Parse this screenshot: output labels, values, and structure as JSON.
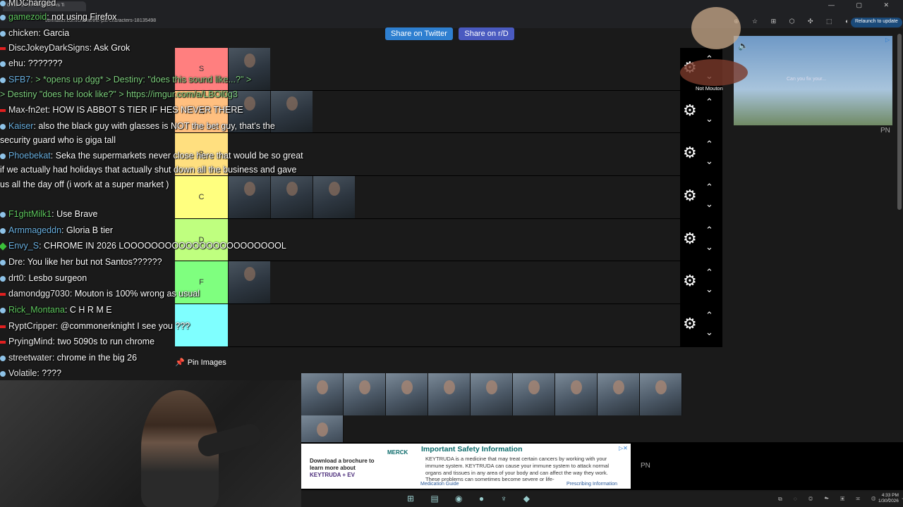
{
  "browser": {
    "tab_title": "Create a The Pitt characters Ti",
    "url": "tiermaker.com/create/the-pitt-characters-18135498",
    "window_controls": "—  ▢  ✕",
    "relaunch_label": "Relaunch to update"
  },
  "share": {
    "twitter_label": "Share on Twitter",
    "reddit_label": "Share on r/D"
  },
  "tiers": [
    {
      "label": "S",
      "color": "#ff7f7f",
      "image_count": 1
    },
    {
      "label": "A",
      "color": "#ffbf7f",
      "image_count": 2
    },
    {
      "label": "B",
      "color": "#ffdf7f",
      "image_count": 0
    },
    {
      "label": "C",
      "color": "#ffff7f",
      "image_count": 3
    },
    {
      "label": "D",
      "color": "#bfff7f",
      "image_count": 0
    },
    {
      "label": "F",
      "color": "#7fff7f",
      "image_count": 1
    },
    {
      "label": "",
      "color": "#7fffff",
      "image_count": 0
    }
  ],
  "tier_controls": {
    "gear_icon": "⚙",
    "up_icon": "⌃",
    "down_icon": "⌄"
  },
  "chat": [
    {
      "badge": "blue",
      "user": "MDCharged",
      "user_color": "#f0f0f0",
      "text": "",
      "wrap": false
    },
    {
      "badge": "blue",
      "user": "gamezoid",
      "user_color": "#5fc85f",
      "text": ": not using Firefox",
      "wrap": false
    },
    {
      "badge": "blue",
      "user": "chicken",
      "user_color": "#f0f0f0",
      "text": ": Garcia",
      "wrap": false
    },
    {
      "badge": "red",
      "user": "DiscJokeyDarkSigns",
      "user_color": "#f0f0f0",
      "text": ": Ask Grok",
      "wrap": false
    },
    {
      "badge": "blue",
      "user": "ehu",
      "user_color": "#f0f0f0",
      "text": ": ???????",
      "wrap": false
    },
    {
      "badge": "blue",
      "user": "SFB7",
      "user_color": "#6ab0e0",
      "text": ": > *opens up dgg* > Destiny: \"does this sound like...?\" >",
      "wrap": false,
      "text_color": "#7fd07f"
    },
    {
      "badge": "",
      "user": "",
      "user_color": "#7fd07f",
      "text": "> Destiny \"does he look like?\" >  https://imgur.com/a/LBOl0g3",
      "wrap": false,
      "text_color": "#7fd07f"
    },
    {
      "badge": "red",
      "user": "Max-fn2et",
      "user_color": "#f0f0f0",
      "text": ": HOW IS ABBOT S TIER IF HES NEVER THERE",
      "wrap": false
    },
    {
      "badge": "blue",
      "user": "Kaiser",
      "user_color": "#6ab0e0",
      "text": ": also the black guy with glasses is NOT the bet guy, that's the security guard who is giga tall",
      "wrap": true
    },
    {
      "badge": "blue",
      "user": "Phoebekat",
      "user_color": "#6ab0e0",
      "text": ": Seka the supermarkets never close here  that would be so great if we actually had holidays that actually shut down all the business and gave us all the day off (i work at a super market  )",
      "wrap": true
    },
    {
      "badge": "blue",
      "user": "F1ghtMilk1",
      "user_color": "#5fc85f",
      "text": ": Use Brave",
      "wrap": false
    },
    {
      "badge": "blue",
      "user": "Armmageddn",
      "user_color": "#6ab0e0",
      "text": ": Gloria B tier",
      "wrap": false
    },
    {
      "badge": "green",
      "user": "Envy_S",
      "user_color": "#6ab0e0",
      "text": ": CHROME IN 2026 LOOOOOOOOOOOOOOOOOOOOOOOL",
      "wrap": false
    },
    {
      "badge": "blue",
      "user": "Dre",
      "user_color": "#f0f0f0",
      "text": ": You like her but not Santos??????",
      "wrap": false
    },
    {
      "badge": "blue",
      "user": "drt0",
      "user_color": "#f0f0f0",
      "text": ": Lesbo surgeon",
      "wrap": false
    },
    {
      "badge": "red",
      "user": "damondgg7030",
      "user_color": "#f0f0f0",
      "text": ": Mouton is 100% wrong as usual",
      "wrap": false
    },
    {
      "badge": "blue",
      "user": "Rick_Montana",
      "user_color": "#5fc85f",
      "text": ": C H R  M E",
      "wrap": false
    },
    {
      "badge": "red",
      "user": "RyptCripper",
      "user_color": "#f0f0f0",
      "text": ": @commonerknight I see you ???",
      "wrap": false
    },
    {
      "badge": "red",
      "user": "PryingMind",
      "user_color": "#f0f0f0",
      "text": ": two 5090s to run chrome",
      "wrap": false
    },
    {
      "badge": "blue",
      "user": "streetwater",
      "user_color": "#f0f0f0",
      "text": ": chrome in the big 26",
      "wrap": false
    },
    {
      "badge": "blue",
      "user": "Volatile",
      "user_color": "#f0f0f0",
      "text": ": ????",
      "wrap": false
    }
  ],
  "pin_label": "Pin Images",
  "tray_image_count": 10,
  "ad": {
    "left_text": "Download a brochure to learn more about",
    "keytruda": "KEYTRUDA + EV",
    "brand": "MERCK",
    "title": "Important Safety Information",
    "body": "KEYTRUDA is a medicine that may treat certain cancers by working with your immune system. KEYTRUDA can cause your immune system to attack normal organs and tissues in any area of your body and can affect the way they work. These problems can sometimes become severe or life-",
    "medication_guide": "Medication Guide",
    "prescribing_info": "Prescribing Information",
    "close": "▷✕"
  },
  "side_ad": {
    "caption": "Can you fix your...",
    "pn": "PN"
  },
  "bottom_pn": "PN",
  "mascot_name": "Not Mouton",
  "taskbar": {
    "apps": "⊞ ▤ ◉ ● ♆ ◆",
    "tray": "⧉ ◌ ◎ ☁ ▣ ✉ ◍ ♪ ⌁",
    "time": "4:33 PM",
    "date": "1/30/2026"
  }
}
